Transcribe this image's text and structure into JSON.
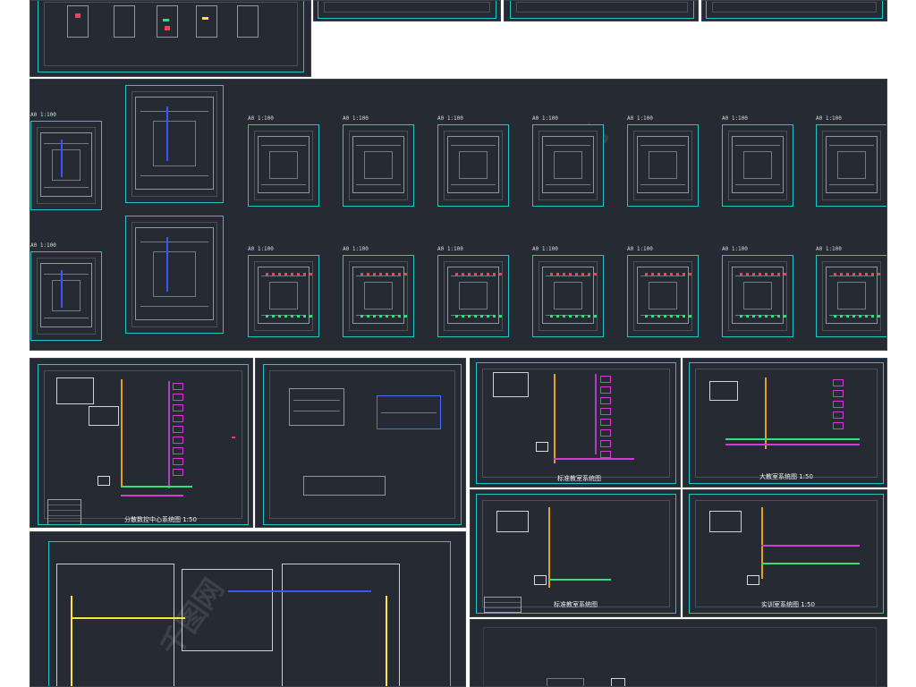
{
  "strip1": {
    "sheets": [
      "",
      "",
      "",
      ""
    ]
  },
  "floorplans": {
    "scale_label": "A0 1:100",
    "row_count": 2,
    "sheets_per_row": 9
  },
  "diagrams": {
    "titles": [
      "分散数控中心系统图 1:50",
      "",
      "标准教室系统图",
      "大教室系统图 1:50",
      "标准教室系统图",
      "实训室系统图 1:50"
    ]
  },
  "bottom_table": {
    "headers": [
      "",
      "",
      "",
      "",
      ""
    ],
    "row_labels": [
      "",
      "",
      "",
      "",
      ""
    ]
  },
  "watermark": "千图网",
  "colors": {
    "background": "#262b33",
    "sheet_border": "#21c6c6",
    "accent_purple": "#d33ad8",
    "accent_green": "#2ee07a",
    "accent_red": "#ff3b5b",
    "accent_blue": "#3b56ff",
    "accent_yellow": "#ffe04a"
  }
}
